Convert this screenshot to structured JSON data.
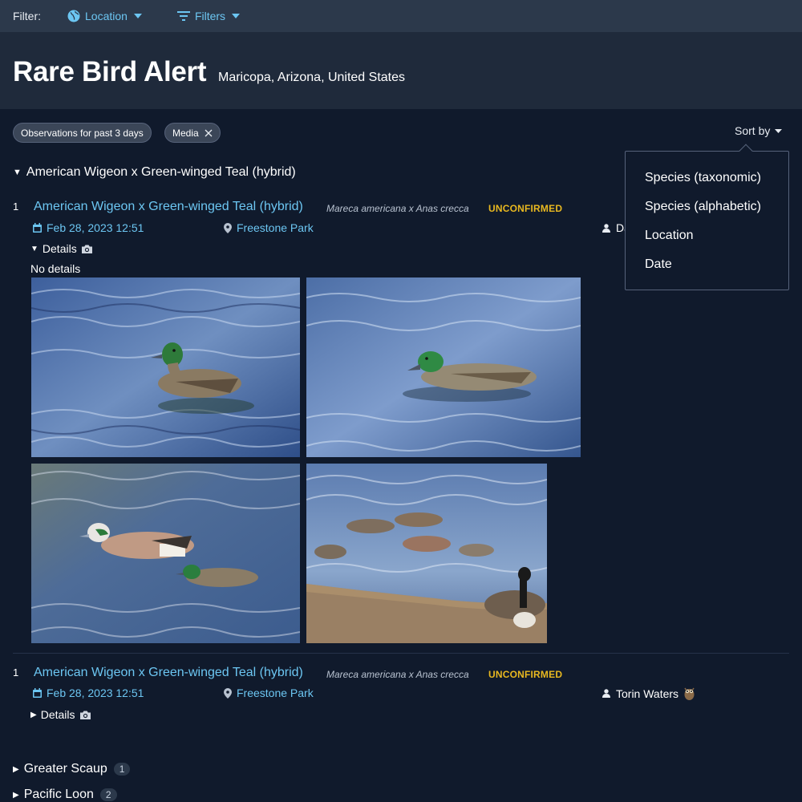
{
  "filterbar": {
    "label": "Filter:",
    "location_label": "Location",
    "filters_label": "Filters"
  },
  "header": {
    "title": "Rare Bird Alert",
    "region": "Maricopa, Arizona, United States"
  },
  "chips": {
    "period": "Observations for past 3 days",
    "media": "Media"
  },
  "sort": {
    "label": "Sort by",
    "options": [
      "Species (taxonomic)",
      "Species (alphabetic)",
      "Location",
      "Date"
    ]
  },
  "groups": [
    {
      "name": "American Wigeon x Green-winged Teal (hybrid)",
      "expanded": true,
      "observations": [
        {
          "count": "1",
          "species": "American Wigeon x Green-winged Teal (hybrid)",
          "scientific": "Mareca americana x Anas crecca",
          "status": "UNCONFIRMED",
          "date": "Feb 28, 2023 12:51",
          "location": "Freestone Park",
          "observer": "Da",
          "details_label": "Details",
          "details_text": "No details",
          "photo_count": 4
        },
        {
          "count": "1",
          "species": "American Wigeon x Green-winged Teal (hybrid)",
          "scientific": "Mareca americana x Anas crecca",
          "status": "UNCONFIRMED",
          "date": "Feb 28, 2023 12:51",
          "location": "Freestone Park",
          "observer": "Torin Waters",
          "details_label": "Details"
        }
      ]
    },
    {
      "name": "Greater Scaup",
      "count": "1",
      "expanded": false
    },
    {
      "name": "Pacific Loon",
      "count": "2",
      "expanded": false
    }
  ],
  "colors": {
    "link": "#6cc6f2",
    "status": "#e8b820",
    "background": "#101a2c",
    "filterbar": "#2c394b",
    "header": "#1f2a3b"
  },
  "icons": [
    "globe-icon",
    "filter-icon",
    "chevron-down-icon",
    "close-icon",
    "calendar-icon",
    "map-pin-icon",
    "user-icon",
    "camera-icon",
    "owl-badge-icon"
  ]
}
